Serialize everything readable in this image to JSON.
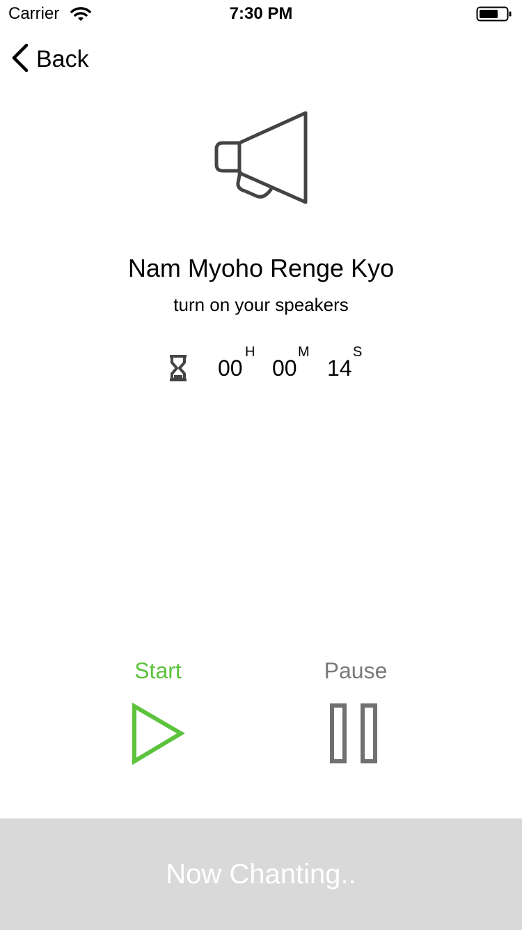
{
  "status_bar": {
    "carrier": "Carrier",
    "time": "7:30 PM",
    "icons": [
      "wifi-icon",
      "battery-icon"
    ]
  },
  "nav": {
    "back_label": "Back",
    "back_icon": "chevron-left-icon"
  },
  "main": {
    "icon": "megaphone-icon",
    "title": "Nam Myoho Renge Kyo",
    "subtitle": "turn on your speakers"
  },
  "timer": {
    "icon": "hourglass-icon",
    "hours": "00",
    "hours_unit": "H",
    "minutes": "00",
    "minutes_unit": "M",
    "seconds": "14",
    "seconds_unit": "S"
  },
  "controls": {
    "start_label": "Start",
    "start_icon": "play-icon",
    "pause_label": "Pause",
    "pause_icon": "pause-icon"
  },
  "footer": {
    "status": "Now Chanting.."
  },
  "colors": {
    "start": "#5cc33c",
    "pause": "#7a7a7a",
    "footer_bg": "#d9d9d9",
    "icon_dark": "#444444"
  }
}
